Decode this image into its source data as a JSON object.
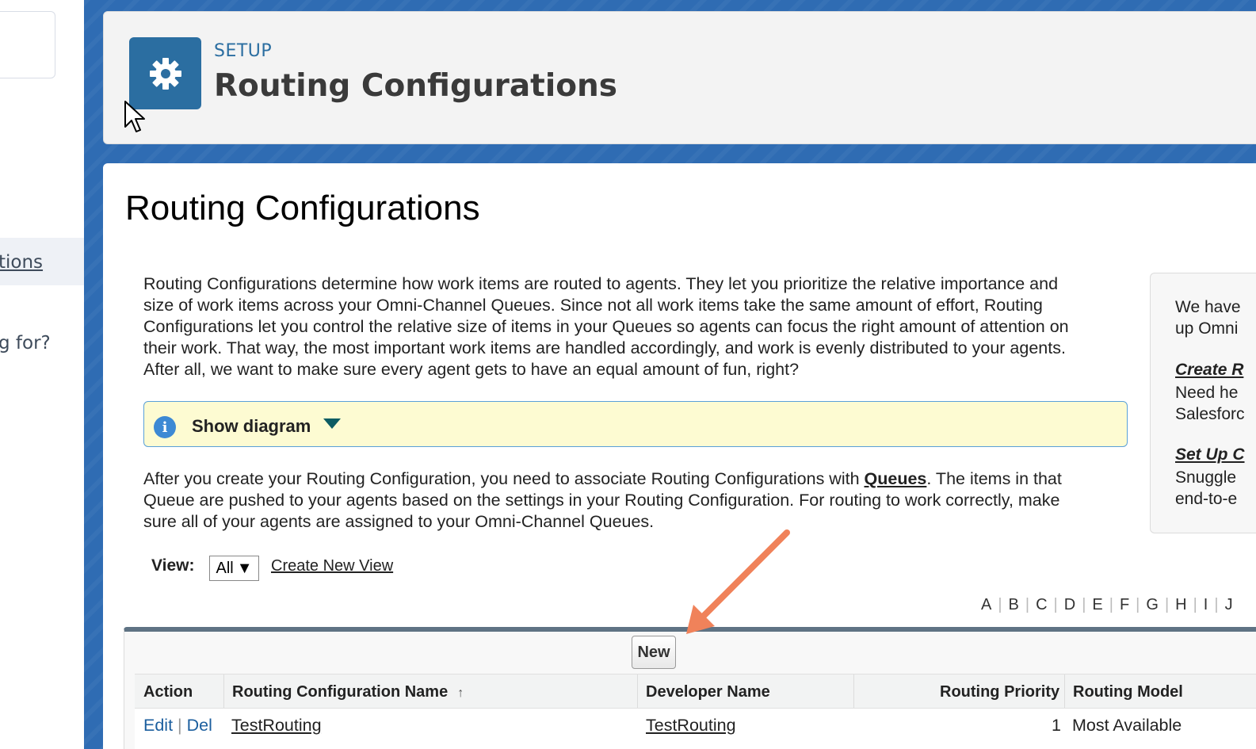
{
  "sidebar": {
    "item_label": "tions",
    "question_text": "g for?"
  },
  "header": {
    "breadcrumb": "SETUP",
    "title": "Routing Configurations",
    "icon": "gear-icon"
  },
  "main": {
    "title": "Routing Configurations",
    "intro_lines": [
      "Routing Configurations determine how work items are routed to agents. They let you prioritize the relative importance and",
      "size of work items across your Omni-Channel Queues. Since not all work items take the same amount of effort, Routing",
      "Configurations let you control the relative size of items in your Queues so agents can focus the right amount of attention on",
      "their work. That way, the most important work items are handled accordingly, and work is evenly distributed to your agents.",
      "After all, we want to make sure every agent gets to have an equal amount of fun, right?"
    ],
    "diagram_label": "Show diagram",
    "assoc_before": "After you create your Routing Configuration, you need to associate Routing Configurations with ",
    "assoc_link": "Queues",
    "assoc_after_line1": ". The items in that",
    "assoc_line2": "Queue are pushed to your agents based on the settings in your Routing Configuration. For routing to work correctly, make",
    "assoc_line3": "sure all of your agents are assigned to your Omni-Channel Queues."
  },
  "help": {
    "line1": "We have",
    "line2": "up Omni",
    "link1": "Create R",
    "line3": "Need he",
    "line4": "Salesforc",
    "link2": "Set Up C",
    "line5": "Snuggle",
    "line6": "end-to-e"
  },
  "view": {
    "label": "View:",
    "selected": "All",
    "create_link": "Create New View"
  },
  "alphabet": [
    "A",
    "B",
    "C",
    "D",
    "E",
    "F",
    "G",
    "H",
    "I",
    "J"
  ],
  "table": {
    "new_label": "New",
    "headers": {
      "action": "Action",
      "name": "Routing Configuration Name",
      "developer": "Developer Name",
      "priority": "Routing Priority",
      "model": "Routing Model"
    },
    "rows": [
      {
        "edit": "Edit",
        "del": "Del",
        "name": "TestRouting",
        "developer": "TestRouting",
        "priority": "1",
        "model": "Most Available"
      }
    ]
  },
  "colors": {
    "brand_blue": "#2b6ea1",
    "backdrop": "#2f6cb3",
    "info_box": "#fdfbd2",
    "annotation_arrow": "#f0825a"
  }
}
